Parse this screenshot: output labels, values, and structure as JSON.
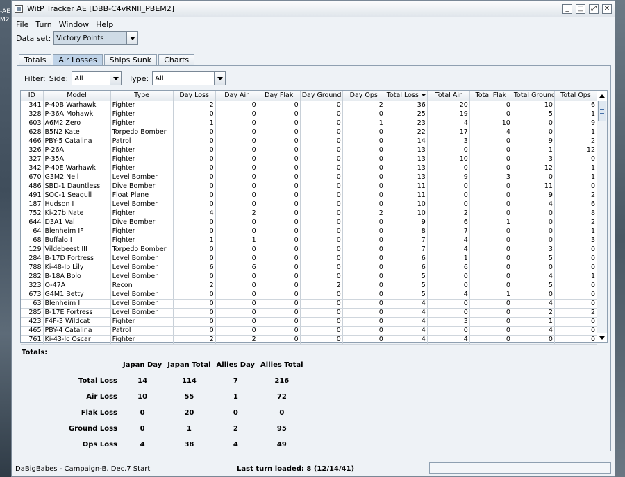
{
  "desktop": {
    "left_text_1": "-AE",
    "left_text_2": "M2"
  },
  "window": {
    "title": "WitP Tracker AE [DBB-C4vRNII_PBEM2]"
  },
  "menu": [
    "File",
    "Turn",
    "Window",
    "Help"
  ],
  "dataset": {
    "label": "Data set:",
    "value": "Victory Points"
  },
  "tabs": [
    "Totals",
    "Air Losses",
    "Ships Sunk",
    "Charts"
  ],
  "active_tab": "Air Losses",
  "filter": {
    "label": "Filter:",
    "side_label": "Side:",
    "side_value": "All",
    "type_label": "Type:",
    "type_value": "All"
  },
  "table": {
    "columns": [
      "ID",
      "Model",
      "Type",
      "Day Loss",
      "Day Air",
      "Day Flak",
      "Day Ground",
      "Day Ops",
      "Total Loss",
      "Total Air",
      "Total Flak",
      "Total Ground",
      "Total Ops"
    ],
    "sort_column": "Total Loss",
    "rows": [
      [
        "341",
        "P-40B Warhawk",
        "Fighter",
        "2",
        "0",
        "0",
        "0",
        "2",
        "36",
        "20",
        "0",
        "10",
        "6"
      ],
      [
        "328",
        "P-36A Mohawk",
        "Fighter",
        "0",
        "0",
        "0",
        "0",
        "0",
        "25",
        "19",
        "0",
        "5",
        "1"
      ],
      [
        "603",
        "A6M2 Zero",
        "Fighter",
        "1",
        "0",
        "0",
        "0",
        "1",
        "23",
        "4",
        "10",
        "0",
        "9"
      ],
      [
        "628",
        "B5N2 Kate",
        "Torpedo Bomber",
        "0",
        "0",
        "0",
        "0",
        "0",
        "22",
        "17",
        "4",
        "0",
        "1"
      ],
      [
        "466",
        "PBY-5 Catalina",
        "Patrol",
        "0",
        "0",
        "0",
        "0",
        "0",
        "14",
        "3",
        "0",
        "9",
        "2"
      ],
      [
        "326",
        "P-26A",
        "Fighter",
        "0",
        "0",
        "0",
        "0",
        "0",
        "13",
        "0",
        "0",
        "1",
        "12"
      ],
      [
        "327",
        "P-35A",
        "Fighter",
        "0",
        "0",
        "0",
        "0",
        "0",
        "13",
        "10",
        "0",
        "3",
        "0"
      ],
      [
        "342",
        "P-40E Warhawk",
        "Fighter",
        "0",
        "0",
        "0",
        "0",
        "0",
        "13",
        "0",
        "0",
        "12",
        "1"
      ],
      [
        "670",
        "G3M2 Nell",
        "Level Bomber",
        "0",
        "0",
        "0",
        "0",
        "0",
        "13",
        "9",
        "3",
        "0",
        "1"
      ],
      [
        "486",
        "SBD-1 Dauntless",
        "Dive Bomber",
        "0",
        "0",
        "0",
        "0",
        "0",
        "11",
        "0",
        "0",
        "11",
        "0"
      ],
      [
        "491",
        "SOC-1 Seagull",
        "Float Plane",
        "0",
        "0",
        "0",
        "0",
        "0",
        "11",
        "0",
        "0",
        "9",
        "2"
      ],
      [
        "187",
        "Hudson I",
        "Level Bomber",
        "0",
        "0",
        "0",
        "0",
        "0",
        "10",
        "0",
        "0",
        "4",
        "6"
      ],
      [
        "752",
        "Ki-27b Nate",
        "Fighter",
        "4",
        "2",
        "0",
        "0",
        "2",
        "10",
        "2",
        "0",
        "0",
        "8"
      ],
      [
        "644",
        "D3A1 Val",
        "Dive Bomber",
        "0",
        "0",
        "0",
        "0",
        "0",
        "9",
        "6",
        "1",
        "0",
        "2"
      ],
      [
        "64",
        "Blenheim IF",
        "Fighter",
        "0",
        "0",
        "0",
        "0",
        "0",
        "8",
        "7",
        "0",
        "0",
        "1"
      ],
      [
        "68",
        "Buffalo I",
        "Fighter",
        "1",
        "1",
        "0",
        "0",
        "0",
        "7",
        "4",
        "0",
        "0",
        "3"
      ],
      [
        "129",
        "Vildebeest III",
        "Torpedo Bomber",
        "0",
        "0",
        "0",
        "0",
        "0",
        "7",
        "4",
        "0",
        "3",
        "0"
      ],
      [
        "284",
        "B-17D Fortress",
        "Level Bomber",
        "0",
        "0",
        "0",
        "0",
        "0",
        "6",
        "1",
        "0",
        "5",
        "0"
      ],
      [
        "788",
        "Ki-48-Ib Lily",
        "Level Bomber",
        "6",
        "6",
        "0",
        "0",
        "0",
        "6",
        "6",
        "0",
        "0",
        "0"
      ],
      [
        "282",
        "B-18A Bolo",
        "Level Bomber",
        "0",
        "0",
        "0",
        "0",
        "0",
        "5",
        "0",
        "0",
        "4",
        "1"
      ],
      [
        "323",
        "O-47A",
        "Recon",
        "2",
        "0",
        "0",
        "2",
        "0",
        "5",
        "0",
        "0",
        "5",
        "0"
      ],
      [
        "673",
        "G4M1 Betty",
        "Level Bomber",
        "0",
        "0",
        "0",
        "0",
        "0",
        "5",
        "4",
        "1",
        "0",
        "0"
      ],
      [
        "63",
        "Blenheim I",
        "Level Bomber",
        "0",
        "0",
        "0",
        "0",
        "0",
        "4",
        "0",
        "0",
        "4",
        "0"
      ],
      [
        "285",
        "B-17E Fortress",
        "Level Bomber",
        "0",
        "0",
        "0",
        "0",
        "0",
        "4",
        "0",
        "0",
        "2",
        "2"
      ],
      [
        "423",
        "F4F-3 Wildcat",
        "Fighter",
        "0",
        "0",
        "0",
        "0",
        "0",
        "4",
        "3",
        "0",
        "1",
        "0"
      ],
      [
        "465",
        "PBY-4 Catalina",
        "Patrol",
        "0",
        "0",
        "0",
        "0",
        "0",
        "4",
        "0",
        "0",
        "4",
        "0"
      ],
      [
        "761",
        "Ki-43-Ic Oscar",
        "Fighter",
        "2",
        "2",
        "0",
        "0",
        "0",
        "4",
        "4",
        "0",
        "0",
        "0"
      ]
    ]
  },
  "totals": {
    "title": "Totals:",
    "columns": [
      "Japan Day",
      "Japan Total",
      "Allies Day",
      "Allies Total"
    ],
    "rows": [
      {
        "label": "Total Loss",
        "values": [
          "14",
          "114",
          "7",
          "216"
        ]
      },
      {
        "label": "Air Loss",
        "values": [
          "10",
          "55",
          "1",
          "72"
        ]
      },
      {
        "label": "Flak Loss",
        "values": [
          "0",
          "20",
          "0",
          "0"
        ]
      },
      {
        "label": "Ground Loss",
        "values": [
          "0",
          "1",
          "2",
          "95"
        ]
      },
      {
        "label": "Ops Loss",
        "values": [
          "4",
          "38",
          "4",
          "49"
        ]
      }
    ]
  },
  "status": {
    "left": "DaBigBabes - Campaign-B, Dec.7 Start",
    "middle": "Last turn loaded: 8 (12/14/41)"
  }
}
